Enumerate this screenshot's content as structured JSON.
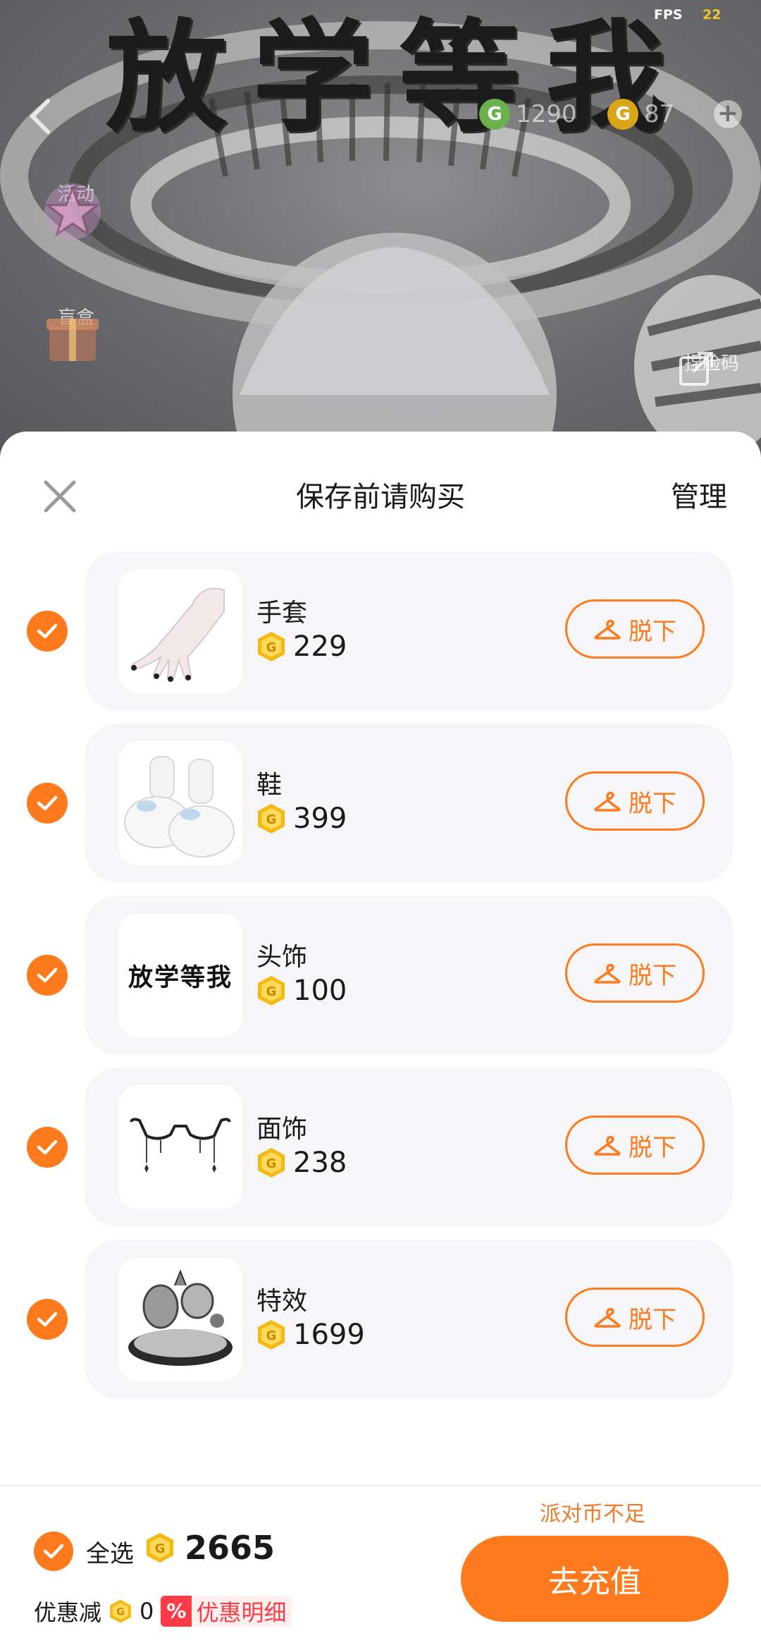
{
  "status": {
    "fps_label": "FPS",
    "fps_value": "22"
  },
  "top_bar": {
    "green_coins": "1290",
    "gold_coins": "87"
  },
  "scene": {
    "banner_text": "放学等我",
    "side_buttons": [
      {
        "label": "活动",
        "icon": "star-icon"
      },
      {
        "label": "盲盒",
        "icon": "gift-box-icon"
      }
    ],
    "face_code_label": "捏脸码"
  },
  "sheet": {
    "title": "保存前请购买",
    "manage_label": "管理",
    "items": [
      {
        "name": "手套",
        "price": "229",
        "action": "脱下",
        "thumb": "gloves"
      },
      {
        "name": "鞋",
        "price": "399",
        "action": "脱下",
        "thumb": "shoes"
      },
      {
        "name": "头饰",
        "price": "100",
        "action": "脱下",
        "thumb": "headwear",
        "thumb_text": "放学等我"
      },
      {
        "name": "面饰",
        "price": "238",
        "action": "脱下",
        "thumb": "glasses"
      },
      {
        "name": "特效",
        "price": "1699",
        "action": "脱下",
        "thumb": "effect"
      }
    ]
  },
  "footer": {
    "select_all_label": "全选",
    "total": "2665",
    "discount_label": "优惠减",
    "discount_value": "0",
    "discount_badge": "%",
    "discount_detail": "优惠明细",
    "insufficient_text": "派对币不足",
    "recharge_label": "去充值"
  },
  "colors": {
    "accent": "#ff7a1c",
    "coin_gold": "#f5b914",
    "discount_red": "#ff3b48"
  }
}
